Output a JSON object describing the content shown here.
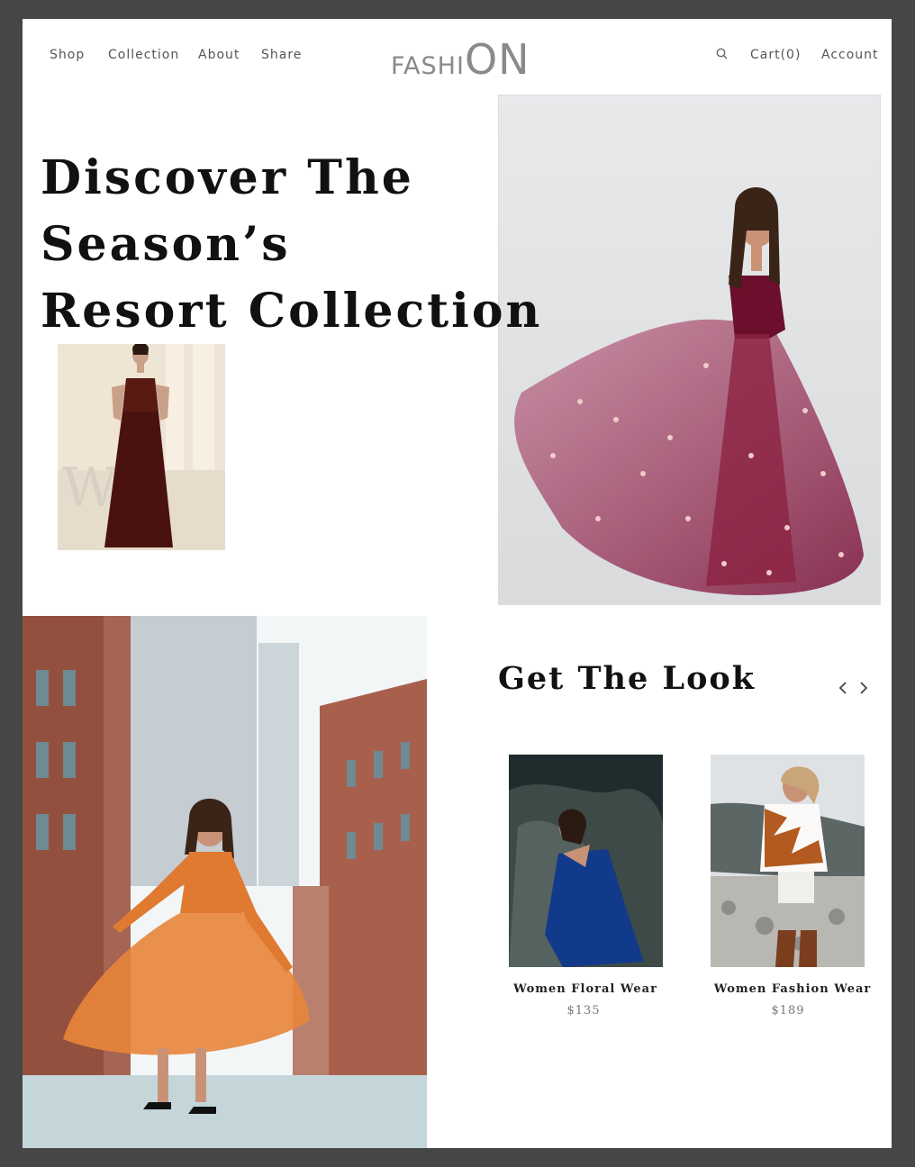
{
  "nav": {
    "left": [
      "Shop",
      "Collection",
      "About",
      "Share"
    ],
    "cart": "Cart(0)",
    "account": "Account"
  },
  "logo": {
    "part1": "FASHI",
    "part2": "ON"
  },
  "hero": {
    "line1": "Discover The Season’s",
    "line2": "Resort Collection"
  },
  "look": {
    "title": "Get The Look",
    "products": [
      {
        "name": "Women Floral Wear",
        "price": "$135"
      },
      {
        "name": "Women Fashion Wear",
        "price": "$189"
      }
    ]
  },
  "colors": {
    "accent": "#8a8a8a",
    "text": "#111111",
    "frame": "#464646"
  }
}
